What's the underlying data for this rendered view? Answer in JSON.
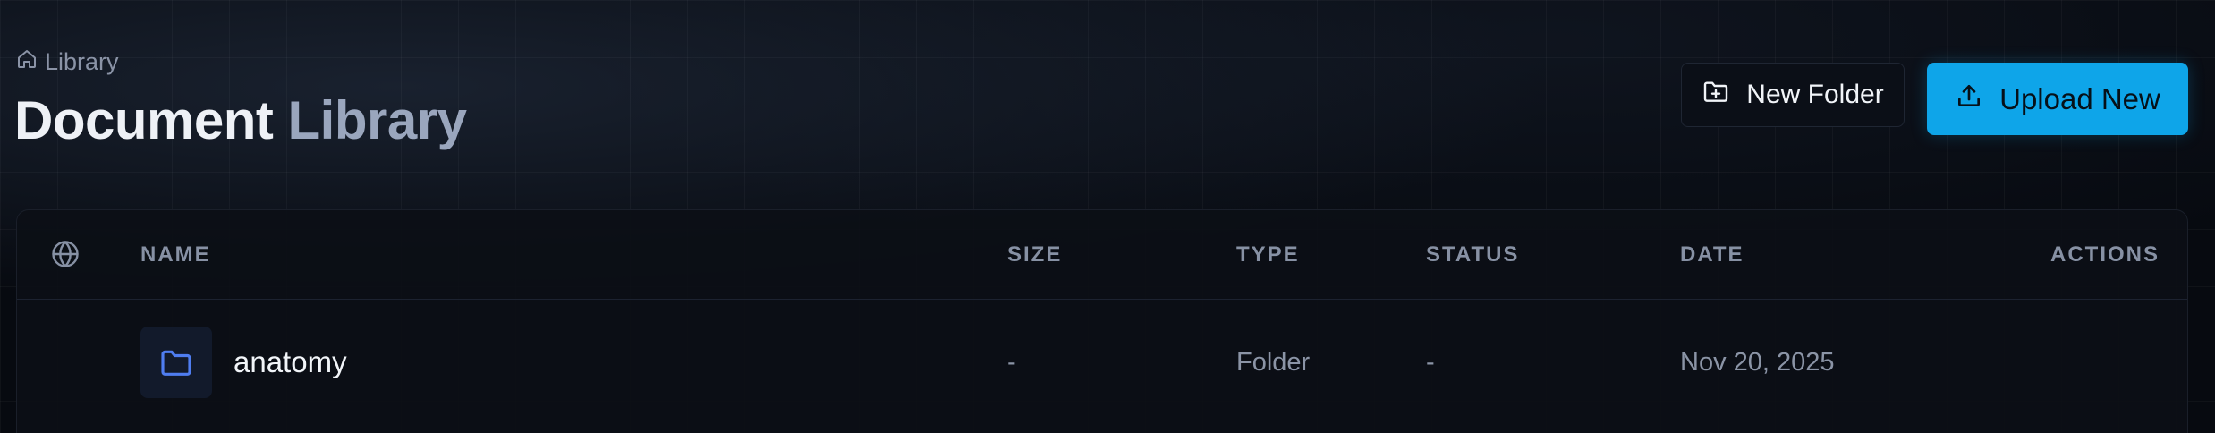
{
  "breadcrumb": {
    "icon": "home-icon",
    "label": "Library"
  },
  "page_title": {
    "part1": "Document",
    "part2": "Library"
  },
  "actions": {
    "new_folder_label": "New Folder",
    "new_folder_icon": "folder-plus-icon",
    "upload_label": "Upload New",
    "upload_icon": "upload-icon",
    "accent_color": "#0ea5e9"
  },
  "table": {
    "header_icon": "globe-icon",
    "columns": [
      "NAME",
      "SIZE",
      "TYPE",
      "STATUS",
      "DATE",
      "ACTIONS"
    ],
    "rows": [
      {
        "icon": "folder-icon",
        "name": "anatomy",
        "size": "-",
        "type": "Folder",
        "status": "-",
        "date": "Nov 20, 2025"
      }
    ]
  }
}
